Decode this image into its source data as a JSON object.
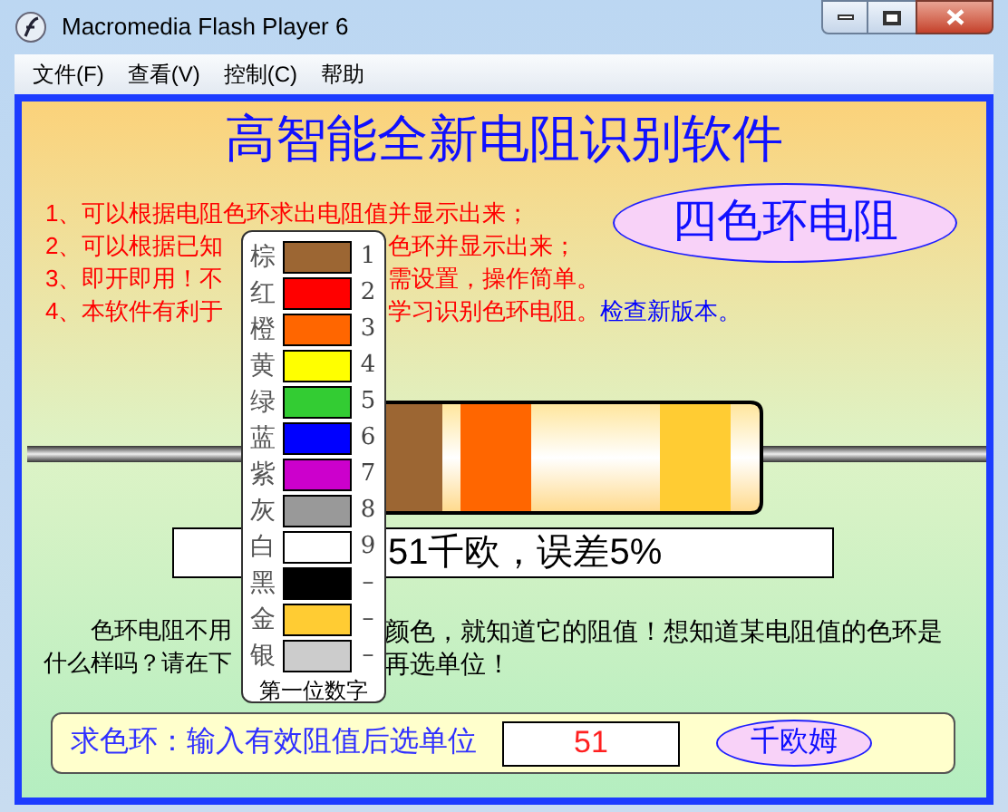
{
  "window": {
    "title": "Macromedia Flash Player 6"
  },
  "menu": [
    "文件(F)",
    "查看(V)",
    "控制(C)",
    "帮助"
  ],
  "heading": "高智能全新电阻识别软件",
  "features": [
    {
      "left": "1、可以根据电阻色环求出电阻值并显示出来；"
    },
    {
      "left": "2、可以根据已知",
      "right": "色环并显示出来；"
    },
    {
      "left": "3、即开即用！不",
      "right": "需设置，操作简单。"
    },
    {
      "left": "4、本软件有利于",
      "right": "学习识别色环电阻。",
      "link": "检查新版本。"
    }
  ],
  "mode_badge": "四色环电阻",
  "resistor_bands": [
    {
      "color": "#9c6633"
    },
    {
      "color": "#ff6600"
    },
    {
      "color": "#ffcc33"
    }
  ],
  "result": "51千欧，误差5%",
  "intro": {
    "line1_left": "色环电阻不用",
    "line1_right": "颜色，就知道它的阻值！想知道某电阻值的色环是",
    "line2_left": "什么样吗？请在下",
    "line2_right": "再选单位！"
  },
  "color_picker": {
    "items": [
      {
        "name": "棕",
        "color": "#9c6633",
        "digit": "1"
      },
      {
        "name": "红",
        "color": "#ff0000",
        "digit": "2"
      },
      {
        "name": "橙",
        "color": "#ff6600",
        "digit": "3"
      },
      {
        "name": "黄",
        "color": "#ffff00",
        "digit": "4"
      },
      {
        "name": "绿",
        "color": "#33cc33",
        "digit": "5"
      },
      {
        "name": "蓝",
        "color": "#0000ff",
        "digit": "6"
      },
      {
        "name": "紫",
        "color": "#cc00cc",
        "digit": "7"
      },
      {
        "name": "灰",
        "color": "#999999",
        "digit": "8"
      },
      {
        "name": "白",
        "color": "#ffffff",
        "digit": "9"
      },
      {
        "name": "黑",
        "color": "#000000",
        "digit": "–"
      },
      {
        "name": "金",
        "color": "#ffcc33",
        "digit": "–"
      },
      {
        "name": "银",
        "color": "#cccccc",
        "digit": "–"
      }
    ],
    "caption": "第一位数字"
  },
  "find_bands": {
    "label": "求色环：输入有效阻值后选单位",
    "value": "51",
    "unit_button": "千欧姆"
  }
}
